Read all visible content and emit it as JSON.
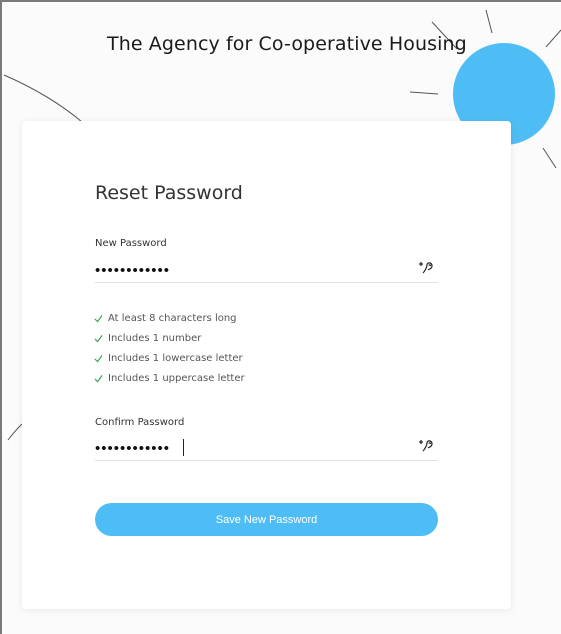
{
  "header": {
    "organization": "The Agency for Co-operative Housing"
  },
  "form": {
    "title": "Reset Password",
    "new_password": {
      "label": "New Password",
      "masked_value": "••••••••••••"
    },
    "confirm_password": {
      "label": "Confirm Password",
      "masked_value": "••••••••••••"
    },
    "requirements": [
      {
        "text": "At least 8 characters long",
        "met": true
      },
      {
        "text": "Includes 1 number",
        "met": true
      },
      {
        "text": "Includes 1 lowercase letter",
        "met": true
      },
      {
        "text": "Includes 1 uppercase letter",
        "met": true
      }
    ],
    "submit_label": "Save New Password"
  },
  "icons": {
    "visibility_toggle": "eye-toggle-icon",
    "requirement_check": "check-icon"
  },
  "colors": {
    "accent": "#4fbdf5",
    "check": "#3aa55c",
    "decoration_sun": "#4fbdf5"
  }
}
